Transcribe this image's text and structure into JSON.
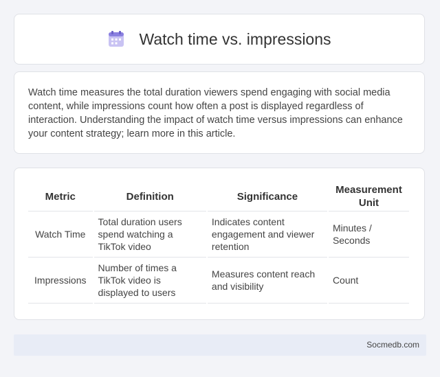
{
  "header": {
    "title": "Watch time vs. impressions",
    "icon": "calendar-icon"
  },
  "summary": "Watch time measures the total duration viewers spend engaging with social media content, while impressions count how often a post is displayed regardless of interaction. Understanding the impact of watch time versus impressions can enhance your content strategy; learn more in this article.",
  "table": {
    "headers": [
      "Metric",
      "Definition",
      "Significance",
      "Measurement Unit"
    ],
    "rows": [
      [
        "Watch Time",
        "Total duration users spend watching a TikTok video",
        "Indicates content engagement and viewer retention",
        "Minutes / Seconds"
      ],
      [
        "Impressions",
        "Number of times a TikTok video is displayed to users",
        "Measures content reach and visibility",
        "Count"
      ]
    ]
  },
  "footer": {
    "site": "Socmedb.com"
  }
}
